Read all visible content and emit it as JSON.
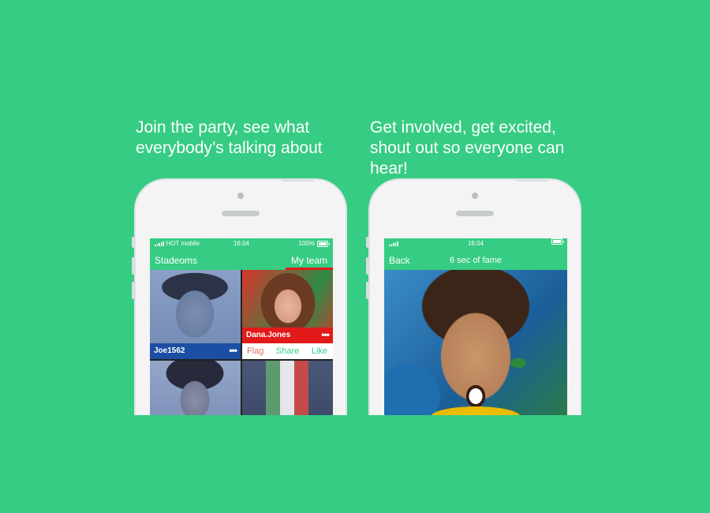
{
  "captions": {
    "left": "Join the party, see what\neverybody’s talking about",
    "right": "Get involved, get excited,\nshout out so everyone can\nhear!"
  },
  "colors": {
    "background": "#36cc83",
    "accent_red": "#e21a1a",
    "tile_blue": "#1c4fa3",
    "action_green": "#36cc83"
  },
  "phone_left": {
    "status": {
      "carrier": "HOT mobile",
      "time": "16:04",
      "battery": "100%"
    },
    "nav": {
      "left": "Stadeoms",
      "right": "My team"
    },
    "tiles": [
      {
        "user": "Joe1562",
        "more": "•••"
      },
      {
        "user": "Dana.Jones",
        "more": "•••"
      }
    ],
    "actions": {
      "flag": "Flag",
      "share": "Share",
      "like": "Like"
    }
  },
  "phone_right": {
    "status": {
      "time": "16:04"
    },
    "nav": {
      "back": "Back",
      "title": "6 sec of fame"
    }
  }
}
